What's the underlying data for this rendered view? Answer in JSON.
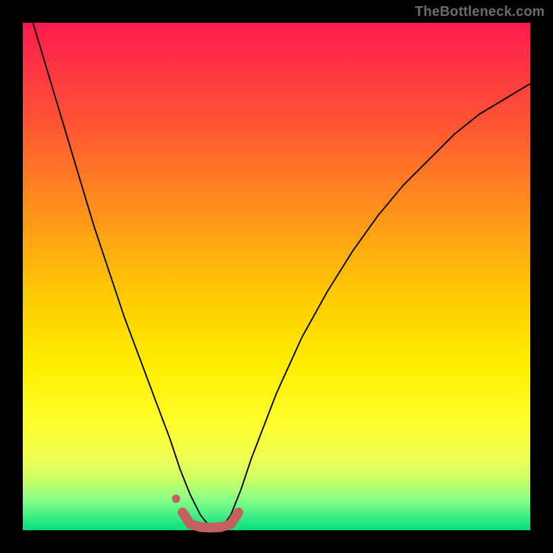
{
  "watermark": "TheBottleneck.com",
  "chart_data": {
    "type": "line",
    "title": "",
    "xlabel": "",
    "ylabel": "",
    "xlim": [
      0,
      100
    ],
    "ylim": [
      0,
      100
    ],
    "grid": false,
    "legend": false,
    "series": [
      {
        "name": "bottleneck-curve",
        "stroke": "#000000",
        "stroke_width": 2,
        "x": [
          2,
          5,
          8,
          11,
          14,
          17,
          20,
          23,
          26,
          29,
          31,
          33,
          35,
          37,
          39,
          41,
          43,
          45,
          50,
          55,
          60,
          65,
          70,
          75,
          80,
          85,
          90,
          95,
          100
        ],
        "values": [
          100,
          90,
          80,
          70,
          60,
          51,
          42,
          34,
          26,
          18,
          12,
          7,
          3,
          0.5,
          0.2,
          3,
          8,
          14,
          27,
          38,
          47,
          55,
          62,
          68,
          73,
          78,
          82,
          85,
          88
        ]
      },
      {
        "name": "confidence-band",
        "stroke": "#c46060",
        "stroke_width": 14,
        "linecap": "round",
        "x": [
          31.5,
          33,
          35,
          37,
          39,
          41,
          42.5
        ],
        "values": [
          3.5,
          1.2,
          0.6,
          0.5,
          0.6,
          1.2,
          3.5
        ]
      },
      {
        "name": "confidence-dot",
        "type_hint": "point",
        "fill": "#c46060",
        "radius": 6,
        "x": [
          30.2
        ],
        "values": [
          6.2
        ]
      }
    ]
  }
}
